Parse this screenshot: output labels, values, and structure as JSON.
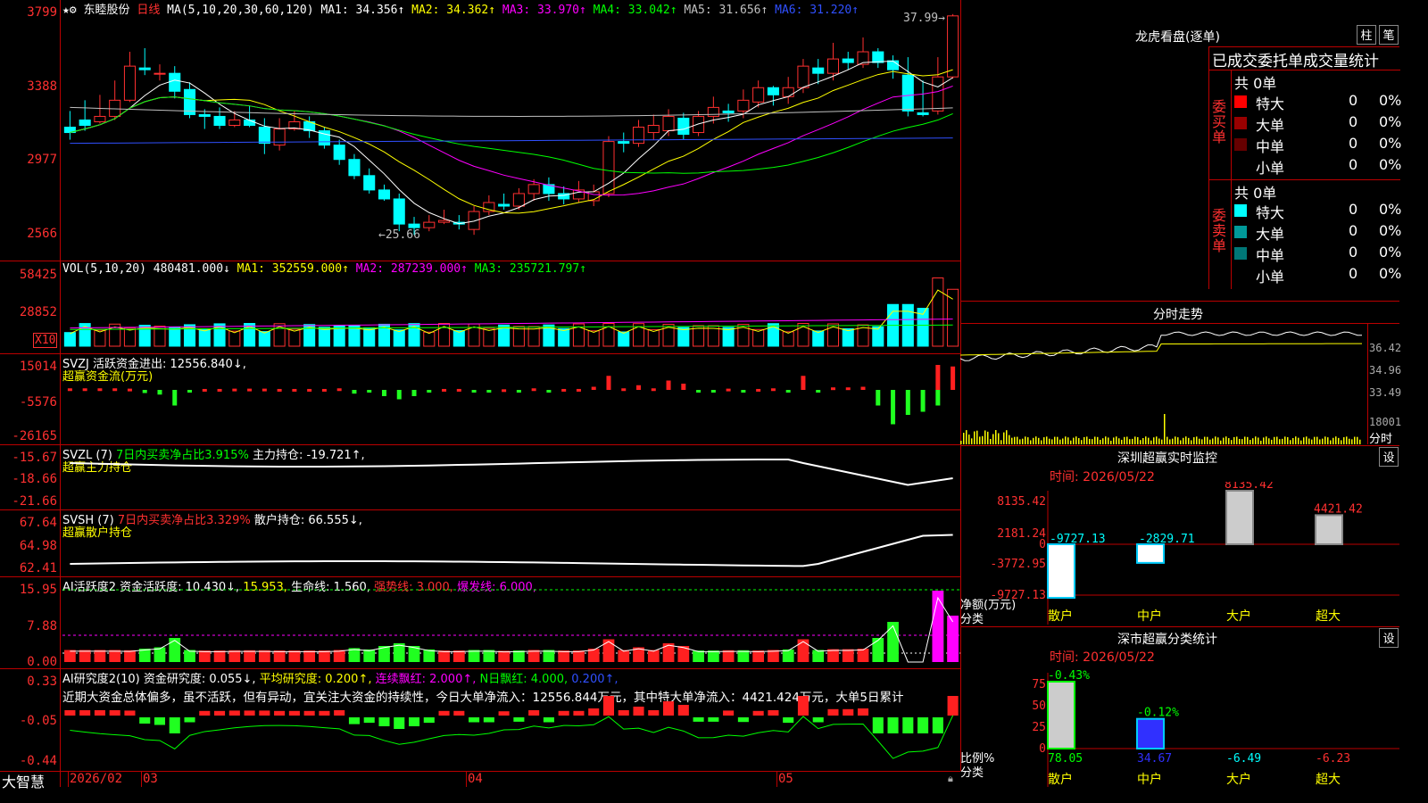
{
  "main": {
    "stock_name": "东睦股份",
    "period": "日线",
    "ma_params": "MA(5,10,20,30,60,120)",
    "ma1": "MA1: 34.356↑",
    "ma2": "MA2: 34.362↑",
    "ma3": "MA3: 33.970↑",
    "ma4": "MA4: 33.042↑",
    "ma5": "MA5: 31.656↑",
    "ma6": "MA6: 31.220↑",
    "y_labels": [
      "3799",
      "3388",
      "2977",
      "2566"
    ],
    "high_label": "37.99",
    "low_label": "←25.66",
    "colors": {
      "ma1": "#ffffff",
      "ma2": "#ffff00",
      "ma3": "#ff00ff",
      "ma4": "#00ff00",
      "ma5": "#c0c0c0",
      "ma6": "#3050ff",
      "up": "#ff3030",
      "down": "#00ffff"
    }
  },
  "vol": {
    "params": "VOL(5,10,20)",
    "value": "480481.000↓",
    "ma1": "MA1: 352559.000↑",
    "ma2": "MA2: 287239.000↑",
    "ma3": "MA3: 235721.797↑",
    "y_labels": [
      "58425",
      "28852"
    ],
    "unit": "X10"
  },
  "svzj": {
    "title": "SVZJ  活跃资金进出: 12556.840↓,",
    "subtitle": "超赢资金流(万元)",
    "y_labels": [
      "15014",
      "-5576",
      "-26165"
    ]
  },
  "svzl": {
    "title_a": "SVZL (7)",
    "title_b": "7日内买卖净占比3.915%",
    "title_c": "主力持仓: -19.721↑,",
    "subtitle": "超赢主力持仓",
    "y_labels": [
      "-15.67",
      "-18.66",
      "-21.66"
    ]
  },
  "svsh": {
    "title_a": "SVSH (7)",
    "title_b": "7日内买卖净占比3.329%",
    "title_c": "散户持仓: 66.555↓,",
    "subtitle": "超赢散户持仓",
    "y_labels": [
      "67.64",
      "64.98",
      "62.41"
    ]
  },
  "ai1": {
    "t1": "AI活跃度2 资金活跃度: 10.430↓,",
    "t2": "15.953,",
    "t3": "生命线: 1.560,",
    "t4": "强势线: 3.000,",
    "t5": "爆发线: 6.000,",
    "y_labels": [
      "15.95",
      "7.88",
      "0.00"
    ]
  },
  "ai2": {
    "t1": "AI研究度2(10) 资金研究度: 0.055↓,",
    "t2": "平均研究度: 0.200↑,",
    "t3": "连续飘红: 2.000↑,",
    "t4": "N日飘红: 4.000,",
    "t5": "0.200↑,",
    "comment": "近期大资金总体偏多，虽不活跃，但有异动，宜关注大资金的持续性，今日大单净流入：12556.844万元，其中特大单净流入：4421.424万元，大单5日累计",
    "y_labels": [
      "0.33",
      "-0.05",
      "-0.44"
    ]
  },
  "footer": {
    "brand": "大智慧",
    "dates": [
      "2026/02",
      "03",
      "04",
      "05"
    ]
  },
  "right": {
    "lhb_title": "龙虎看盘(逐单)",
    "btn_col": "柱",
    "btn_bi": "笔",
    "stats_title": "已成交委托单成交量统计",
    "buy_label": "委买单",
    "sell_label": "委卖单",
    "buy_total": "共 0单",
    "sell_total": "共 0单",
    "buy_rows": [
      {
        "name": "特大",
        "count": "0",
        "pct": "0%",
        "color": "#ff0000"
      },
      {
        "name": "大单",
        "count": "0",
        "pct": "0%",
        "color": "#990000"
      },
      {
        "name": "中单",
        "count": "0",
        "pct": "0%",
        "color": "#660000"
      },
      {
        "name": "小单",
        "count": "0",
        "pct": "0%",
        "color": "#000000"
      }
    ],
    "sell_rows": [
      {
        "name": "特大",
        "count": "0",
        "pct": "0%",
        "color": "#00ffff"
      },
      {
        "name": "大单",
        "count": "0",
        "pct": "0%",
        "color": "#009999"
      },
      {
        "name": "中单",
        "count": "0",
        "pct": "0%",
        "color": "#007777"
      },
      {
        "name": "小单",
        "count": "0",
        "pct": "0%",
        "color": "#000000"
      }
    ],
    "intraday_title": "分时走势",
    "intraday_y": [
      "36.42",
      "34.96",
      "33.49",
      "18001"
    ],
    "intraday_unit": "分时",
    "sz_monitor_title": "深圳超赢实时监控",
    "sz_monitor_btn": "设",
    "sz_monitor_time": "时间: 2026/05/22",
    "sz_chart": {
      "type": "bar",
      "categories": [
        "散户",
        "中户",
        "大户",
        "超大"
      ],
      "values": [
        -9727.13,
        -2829.71,
        8135.42,
        4421.42
      ],
      "y_labels": [
        "8135.42",
        "2181.24",
        "0",
        "-3772.95",
        "-9727.13"
      ],
      "ylabel": "净额(万元)",
      "xlabel": "分类"
    },
    "sz_class_title": "深市超赢分类统计",
    "sz_class_btn": "设",
    "sz_class_time": "时间: 2026/05/22",
    "cls_chart": {
      "type": "bar",
      "categories": [
        "散户",
        "中户",
        "大户",
        "超大"
      ],
      "values": [
        78.05,
        34.67,
        -6.49,
        -6.23
      ],
      "top_labels": [
        "-0.43%",
        "-0.12%"
      ],
      "y_labels": [
        "75",
        "50",
        "25",
        "0"
      ],
      "ylabel": "比例%",
      "xlabel": "分类"
    }
  },
  "chart_data": {
    "type": "bar",
    "title": "深圳超赢实时监控",
    "categories": [
      "散户",
      "中户",
      "大户",
      "超大"
    ],
    "values": [
      -9727.13,
      -2829.71,
      8135.42,
      4421.42
    ],
    "ylabel": "净额(万元)",
    "xlabel": "分类"
  }
}
